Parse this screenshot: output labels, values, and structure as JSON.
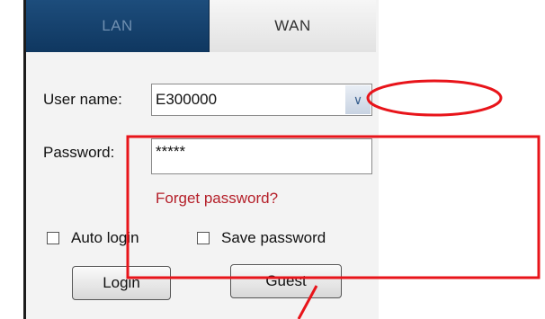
{
  "tabs": [
    {
      "label": "LAN",
      "active": false
    },
    {
      "label": "WAN",
      "active": true
    }
  ],
  "form": {
    "username_label": "User name:",
    "username_value": "E300000",
    "password_label": "Password:",
    "password_value": "*****",
    "forget_link": "Forget password?",
    "auto_login_label": "Auto login",
    "save_password_label": "Save password",
    "login_button": "Login",
    "guest_button": "Guest"
  },
  "icons": {
    "dropdown": "chevron-down-icon"
  },
  "colors": {
    "lan_tab": "#12406b",
    "link": "#b5202a",
    "annotation": "#e8141a"
  }
}
